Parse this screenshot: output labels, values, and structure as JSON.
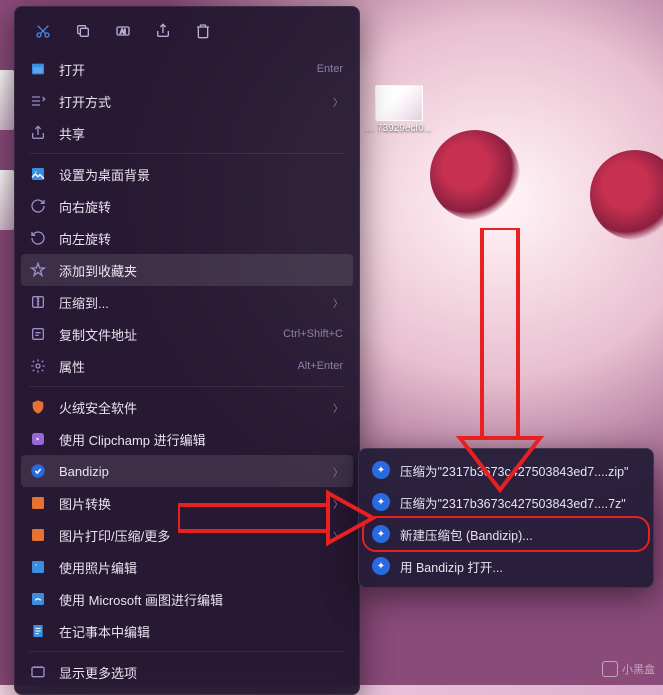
{
  "desktop": {
    "file_label": "... 73929ecf0..."
  },
  "toolbar": [
    {
      "name": "cut-icon"
    },
    {
      "name": "copy-icon"
    },
    {
      "name": "rename-icon"
    },
    {
      "name": "share-icon"
    },
    {
      "name": "delete-icon"
    }
  ],
  "menu": [
    {
      "icon": "open-icon",
      "icon_class": "blue",
      "label": "打开",
      "hint": "Enter",
      "sep": false
    },
    {
      "icon": "open-with-icon",
      "label": "打开方式",
      "chev": true
    },
    {
      "icon": "share-icon",
      "label": "共享",
      "sep_after": true
    },
    {
      "icon": "wallpaper-icon",
      "icon_class": "blue",
      "label": "设置为桌面背景"
    },
    {
      "icon": "rotate-right-icon",
      "label": "向右旋转"
    },
    {
      "icon": "rotate-left-icon",
      "label": "向左旋转"
    },
    {
      "icon": "star-icon",
      "label": "添加到收藏夹",
      "hover": true
    },
    {
      "icon": "compress-icon",
      "label": "压缩到...",
      "chev": true
    },
    {
      "icon": "copy-path-icon",
      "label": "复制文件地址",
      "hint": "Ctrl+Shift+C"
    },
    {
      "icon": "properties-icon",
      "label": "属性",
      "hint": "Alt+Enter",
      "sep_after": true
    },
    {
      "icon": "shield-icon",
      "icon_class": "orange",
      "label": "火绒安全软件",
      "chev": true
    },
    {
      "icon": "clipchamp-icon",
      "icon_class": "purple",
      "label": "使用 Clipchamp 进行编辑"
    },
    {
      "icon": "bandizip-icon",
      "icon_class": "blue",
      "label": "Bandizip",
      "chev": true,
      "hover": true
    },
    {
      "icon": "convert-icon",
      "icon_class": "orange",
      "label": "图片转换",
      "chev": true
    },
    {
      "icon": "print-icon",
      "icon_class": "orange",
      "label": "图片打印/压缩/更多",
      "chev": true
    },
    {
      "icon": "photos-icon",
      "icon_class": "blue",
      "label": "使用照片编辑"
    },
    {
      "icon": "paint-icon",
      "icon_class": "blue",
      "label": "使用 Microsoft 画图进行编辑"
    },
    {
      "icon": "notepad-icon",
      "icon_class": "blue",
      "label": "在记事本中编辑",
      "sep_after": true
    },
    {
      "icon": "more-icon",
      "label": "显示更多选项"
    }
  ],
  "submenu": [
    {
      "label": "压缩为\"2317b3673c427503843ed7....zip\""
    },
    {
      "label": "压缩为\"2317b3673c427503843ed7....7z\""
    },
    {
      "label": "新建压缩包 (Bandizip)...",
      "boxed": true
    },
    {
      "label": "用 Bandizip 打开..."
    }
  ],
  "watermark": {
    "text": "小黑盒"
  },
  "colors": {
    "accent_red": "#e82020",
    "menu_bg": "rgba(30,20,45,.92)"
  }
}
